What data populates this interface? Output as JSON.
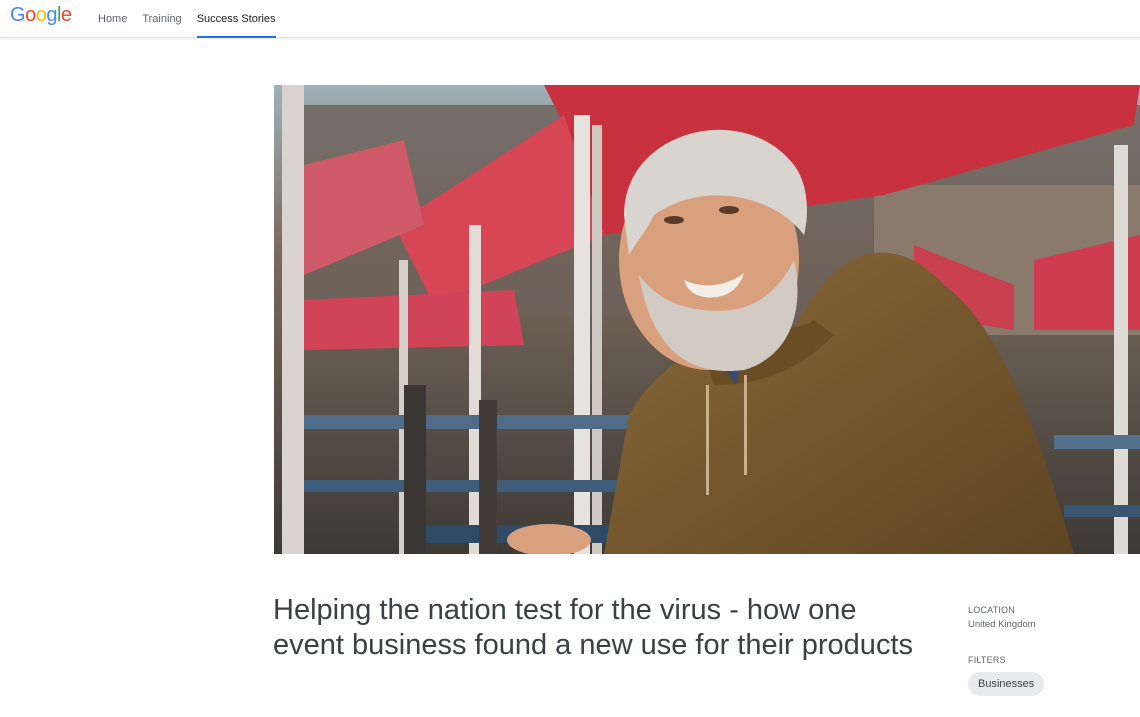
{
  "header": {
    "logo": {
      "text": "Google",
      "letters": [
        "G",
        "o",
        "o",
        "g",
        "l",
        "e"
      ],
      "colors": [
        "#4285F4",
        "#EA4335",
        "#FBBC05",
        "#4285F4",
        "#34A853",
        "#EA4335"
      ]
    },
    "nav": [
      {
        "label": "Home",
        "active": false
      },
      {
        "label": "Training",
        "active": false
      },
      {
        "label": "Success Stories",
        "active": true
      }
    ],
    "accent_color": "#1a73e8"
  },
  "hero": {
    "image": "photo of smiling bearded man in brown hoodie seated under red market canopies"
  },
  "article": {
    "title": "Helping the nation test for the virus - how one event business found a new use for their products"
  },
  "sidebar": {
    "location_label": "LOCATION",
    "location_value": "United Kingdom",
    "filters_label": "FILTERS",
    "filters": [
      "Businesses"
    ]
  }
}
